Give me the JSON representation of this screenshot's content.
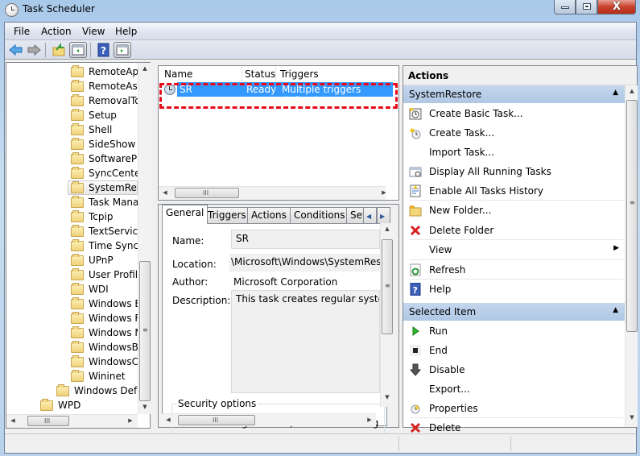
{
  "window": {
    "title": "Task Scheduler",
    "controls": {
      "minimize": "minimize",
      "maximize": "maximize",
      "close": "X"
    }
  },
  "menubar": {
    "items": [
      "File",
      "Action",
      "View",
      "Help"
    ]
  },
  "toolbar": {
    "buttons": [
      "back-icon",
      "forward-icon",
      "up-folder-icon",
      "show-hide-console-tree-icon",
      "help-icon",
      "show-hide-action-pane-icon"
    ]
  },
  "tree": {
    "items": [
      {
        "label": "RemoteApp",
        "level": 3
      },
      {
        "label": "RemoteAss",
        "level": 3
      },
      {
        "label": "RemovalTo",
        "level": 3
      },
      {
        "label": "Setup",
        "level": 3
      },
      {
        "label": "Shell",
        "level": 3
      },
      {
        "label": "SideShow",
        "level": 3
      },
      {
        "label": "SoftwarePro",
        "level": 3
      },
      {
        "label": "SyncCenter",
        "level": 3
      },
      {
        "label": "SystemRest",
        "level": 3,
        "selected": true
      },
      {
        "label": "Task Manag",
        "level": 3
      },
      {
        "label": "Tcpip",
        "level": 3
      },
      {
        "label": "TextService",
        "level": 3
      },
      {
        "label": "Time Synch",
        "level": 3
      },
      {
        "label": "UPnP",
        "level": 3
      },
      {
        "label": "User Profile",
        "level": 3
      },
      {
        "label": "WDI",
        "level": 3
      },
      {
        "label": "Windows Er",
        "level": 3
      },
      {
        "label": "Windows Fi",
        "level": 3
      },
      {
        "label": "Windows M",
        "level": 3
      },
      {
        "label": "WindowsBa",
        "level": 3
      },
      {
        "label": "WindowsCo",
        "level": 3
      },
      {
        "label": "Wininet",
        "level": 3
      },
      {
        "label": "Windows Defer",
        "level": 2
      },
      {
        "label": "WPD",
        "level": 1
      }
    ]
  },
  "tasklist": {
    "columns": [
      "Name",
      "Status",
      "Triggers"
    ],
    "rows": [
      {
        "name": "SR",
        "status": "Ready",
        "triggers": "Multiple triggers defined",
        "selected": true
      }
    ]
  },
  "details": {
    "tabs": [
      "General",
      "Triggers",
      "Actions",
      "Conditions",
      "Set"
    ],
    "active_tab": "General",
    "name_label": "Name:",
    "name_value": "SR",
    "location_label": "Location:",
    "location_value": "\\Microsoft\\Windows\\SystemResto",
    "author_label": "Author:",
    "author_value": "Microsoft Corporation",
    "description_label": "Description:",
    "description_value": "This task creates regular system p",
    "security_group": "Security options",
    "security_text": "When running the task, use the following user"
  },
  "actions": {
    "title": "Actions",
    "sections": [
      {
        "title": "SystemRestore",
        "items": [
          {
            "label": "Create Basic Task...",
            "icon": "create-basic-task-icon"
          },
          {
            "label": "Create Task...",
            "icon": "create-task-icon"
          },
          {
            "label": "Import Task...",
            "icon": ""
          },
          {
            "label": "Display All Running Tasks",
            "icon": "running-tasks-icon"
          },
          {
            "label": "Enable All Tasks History",
            "icon": "tasks-history-icon"
          },
          {
            "label": "New Folder...",
            "icon": "new-folder-icon"
          },
          {
            "label": "Delete Folder",
            "icon": "delete-icon"
          },
          {
            "label": "View",
            "icon": "",
            "submenu": true
          },
          {
            "label": "Refresh",
            "icon": "refresh-icon"
          },
          {
            "label": "Help",
            "icon": "help-icon"
          }
        ]
      },
      {
        "title": "Selected Item",
        "items": [
          {
            "label": "Run",
            "icon": "run-icon"
          },
          {
            "label": "End",
            "icon": "end-icon"
          },
          {
            "label": "Disable",
            "icon": "disable-icon"
          },
          {
            "label": "Export...",
            "icon": ""
          },
          {
            "label": "Properties",
            "icon": "properties-icon"
          },
          {
            "label": "Delete",
            "icon": "delete-icon"
          }
        ]
      }
    ]
  },
  "highlight_color": "#3399ff",
  "annotation_color": "#e8081a"
}
